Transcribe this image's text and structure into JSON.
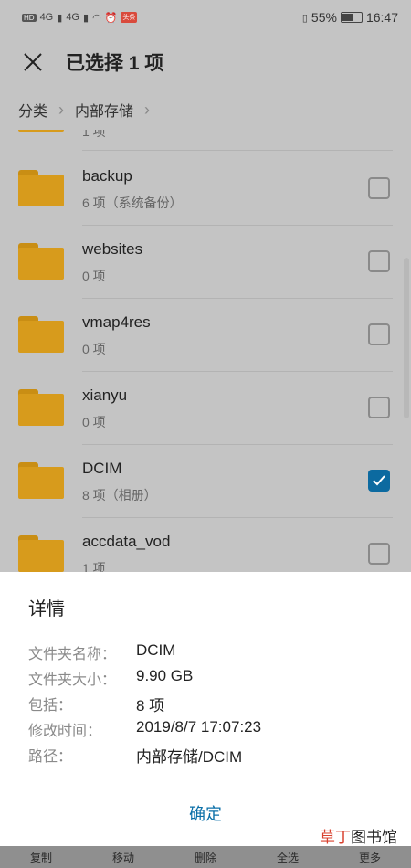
{
  "status_bar": {
    "left_badges": [
      "HD",
      "4G",
      "4G"
    ],
    "notification_badge": "头条",
    "battery": "55%",
    "time": "16:47"
  },
  "header": {
    "title": "已选择 1 项"
  },
  "breadcrumb": {
    "items": [
      "分类",
      "内部存储"
    ]
  },
  "list": {
    "partial_top_meta": "1 项",
    "items": [
      {
        "name": "backup",
        "meta": "6 项（系统备份）",
        "checked": false
      },
      {
        "name": "websites",
        "meta": "0 项",
        "checked": false
      },
      {
        "name": "vmap4res",
        "meta": "0 项",
        "checked": false
      },
      {
        "name": "xianyu",
        "meta": "0 项",
        "checked": false
      },
      {
        "name": "DCIM",
        "meta": "8 项（相册）",
        "checked": true
      },
      {
        "name": "accdata_vod",
        "meta": "1 项",
        "checked": false
      }
    ]
  },
  "details": {
    "title": "详情",
    "rows": [
      {
        "label": "文件夹名称：",
        "value": "DCIM"
      },
      {
        "label": "文件夹大小：",
        "value": "9.90 GB"
      },
      {
        "label": "包括：",
        "value": "8 项"
      },
      {
        "label": "修改时间：",
        "value": "2019/8/7 17:07:23"
      },
      {
        "label": "路径：",
        "value": "内部存储/DCIM"
      }
    ],
    "ok_label": "确定"
  },
  "watermark": {
    "part1": "草丁",
    "part2": "图书馆"
  },
  "bottom_bar": {
    "items": [
      "复制",
      "移动",
      "删除",
      "全选",
      "更多"
    ]
  },
  "colors": {
    "accent": "#0a6fa8",
    "folder": "#d79b1c",
    "checkbox_checked": "#0c6aa0"
  }
}
